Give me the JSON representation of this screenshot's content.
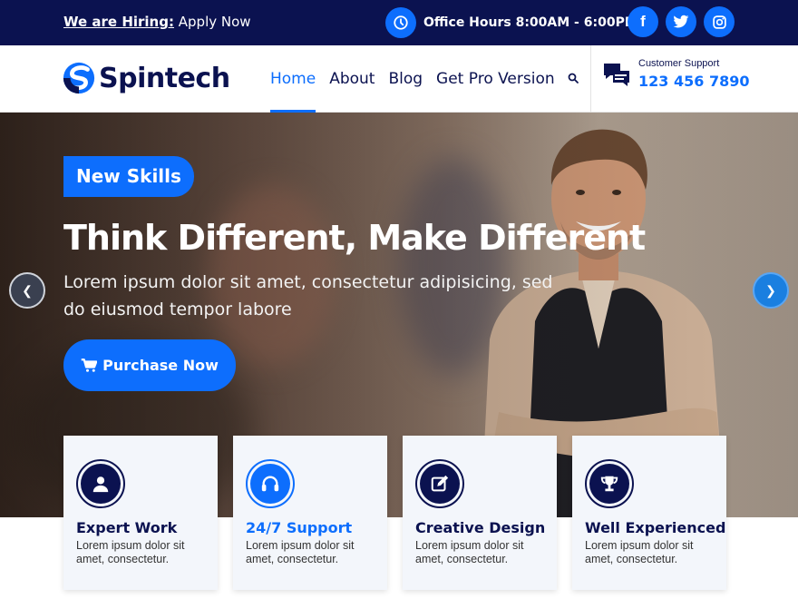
{
  "topbar": {
    "hiring_strong": "We are Hiring:",
    "hiring_link": "Apply Now",
    "hours": "Office Hours 8:00AM - 6:00PM",
    "social": [
      "facebook-icon",
      "twitter-icon",
      "instagram-icon"
    ]
  },
  "header": {
    "logo_text": "Spintech",
    "nav": [
      "Home",
      "About",
      "Blog",
      "Get Pro Version"
    ],
    "active_nav": "Home",
    "support_label": "Customer Support",
    "support_phone": "123 456 7890"
  },
  "hero": {
    "badge": "New Skills",
    "headline": "Think Different, Make Different",
    "subtext": "Lorem ipsum dolor sit amet, consectetur adipisicing, sed do eiusmod tempor labore",
    "cta": "Purchase Now"
  },
  "features": [
    {
      "title": "Expert Work",
      "desc": "Lorem ipsum dolor sit amet, consectetur.",
      "icon": "user-icon"
    },
    {
      "title": "24/7 Support",
      "desc": "Lorem ipsum dolor sit amet, consectetur.",
      "icon": "headset-icon"
    },
    {
      "title": "Creative Design",
      "desc": "Lorem ipsum dolor sit amet, consectetur.",
      "icon": "edit-icon"
    },
    {
      "title": "Well Experienced",
      "desc": "Lorem ipsum dolor sit amet, consectetur.",
      "icon": "trophy-icon"
    }
  ],
  "colors": {
    "navy": "#0b1250",
    "accent": "#0d6efd"
  }
}
